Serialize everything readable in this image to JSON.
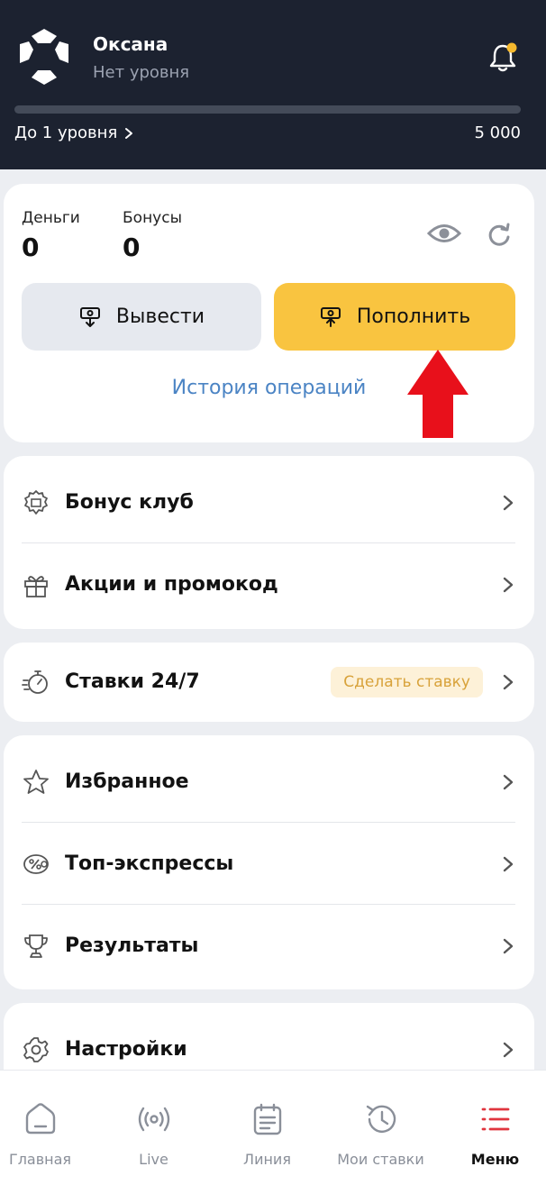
{
  "header": {
    "user_name": "Оксана",
    "user_level": "Нет уровня",
    "level_progress_percent": 0,
    "next_level_label": "До 1 уровня",
    "next_level_target": "5 000"
  },
  "balance": {
    "money_label": "Деньги",
    "money_value": "0",
    "bonus_label": "Бонусы",
    "bonus_value": "0",
    "withdraw_label": "Вывести",
    "deposit_label": "Пополнить",
    "history_label": "История операций"
  },
  "menu": {
    "bonus_club": "Бонус клуб",
    "promos": "Акции и промокод",
    "bets_247": "Ставки 24/7",
    "make_bet_badge": "Сделать ставку",
    "favorites": "Избранное",
    "top_express": "Топ-экспрессы",
    "results": "Результаты",
    "settings": "Настройки"
  },
  "tabbar": {
    "home": "Главная",
    "live": "Live",
    "line": "Линия",
    "my_bets": "Мои ставки",
    "menu": "Меню"
  },
  "colors": {
    "header_bg": "#1c2230",
    "accent_yellow": "#f9c440",
    "link_blue": "#4b84c4",
    "active_red": "#e0353e",
    "arrow_red": "#e8101b"
  },
  "icons": [
    "logo-icon",
    "bell-icon",
    "eye-icon",
    "refresh-icon",
    "withdraw-icon",
    "deposit-icon",
    "medal-icon",
    "gift-icon",
    "stopwatch-icon",
    "star-icon",
    "percent-ticket-icon",
    "trophy-icon",
    "gear-icon",
    "home-icon",
    "live-icon",
    "clipboard-icon",
    "history-icon",
    "menu-list-icon"
  ]
}
